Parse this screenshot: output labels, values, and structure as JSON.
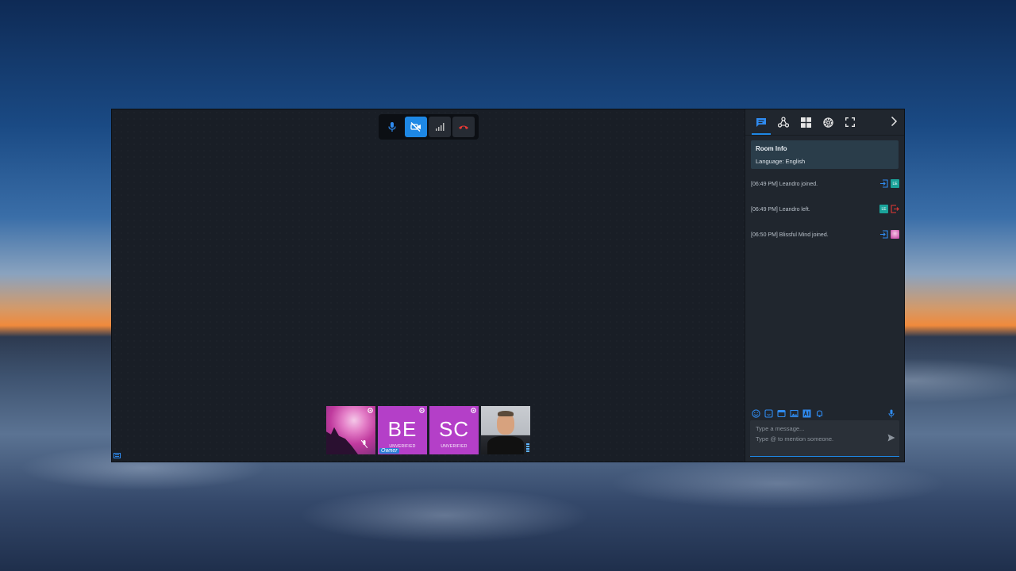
{
  "call_controls": {
    "mic_icon": "microphone-icon",
    "camera_icon": "camera-off-icon",
    "signal_icon": "signal-icon",
    "hangup_icon": "hangup-icon"
  },
  "participants": [
    {
      "kind": "avatar-image",
      "moderated_icon": "gear-icon",
      "muted_icon": "mic-off-icon"
    },
    {
      "kind": "initials",
      "initials": "BE",
      "status": "UNVERIFIED",
      "owner_label": "Owner",
      "color": "#b43fc8"
    },
    {
      "kind": "initials",
      "initials": "SC",
      "status": "UNVERIFIED",
      "color": "#b43fc8"
    },
    {
      "kind": "camera"
    }
  ],
  "sidebar": {
    "tabs": [
      "chat-icon",
      "share-icon",
      "grid-icon",
      "gear-icon",
      "fullscreen-icon"
    ],
    "room_info": {
      "title": "Room Info",
      "language": "Language: English"
    },
    "messages": [
      {
        "text": "[06:49 PM] Leandro joined.",
        "event": "join",
        "avatar": "LE"
      },
      {
        "text": "[06:49 PM] Leandro left.",
        "event": "leave",
        "avatar": "LE"
      },
      {
        "text": "[06:50 PM] Blissful Mind joined.",
        "event": "join",
        "avatar": ""
      }
    ],
    "composer": {
      "placeholder_line1": "Type a message...",
      "placeholder_line2": "Type @ to mention someone."
    }
  },
  "colors": {
    "accent": "#1e88e5",
    "hangup": "#e53935",
    "tile_purple": "#b43fc8",
    "avatar_teal": "#1aa39a",
    "leave_red": "#e53935"
  }
}
